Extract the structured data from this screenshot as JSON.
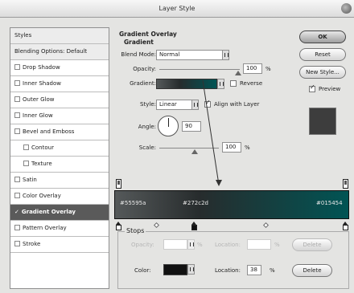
{
  "window": {
    "title": "Layer Style"
  },
  "sidebar": {
    "items": [
      {
        "label": "Styles",
        "checkbox": false,
        "checked": false,
        "active": false,
        "header": true
      },
      {
        "label": "Blending Options: Default",
        "checkbox": false,
        "checked": false,
        "active": false,
        "header": true
      },
      {
        "label": "Drop Shadow",
        "checkbox": true,
        "checked": false,
        "active": false
      },
      {
        "label": "Inner Shadow",
        "checkbox": true,
        "checked": false,
        "active": false
      },
      {
        "label": "Outer Glow",
        "checkbox": true,
        "checked": false,
        "active": false
      },
      {
        "label": "Inner Glow",
        "checkbox": true,
        "checked": false,
        "active": false
      },
      {
        "label": "Bevel and Emboss",
        "checkbox": true,
        "checked": false,
        "active": false
      },
      {
        "label": "Contour",
        "checkbox": true,
        "checked": false,
        "active": false,
        "sub": true
      },
      {
        "label": "Texture",
        "checkbox": true,
        "checked": false,
        "active": false,
        "sub": true
      },
      {
        "label": "Satin",
        "checkbox": true,
        "checked": false,
        "active": false
      },
      {
        "label": "Color Overlay",
        "checkbox": true,
        "checked": false,
        "active": false
      },
      {
        "label": "Gradient Overlay",
        "checkbox": true,
        "checked": true,
        "active": true
      },
      {
        "label": "Pattern Overlay",
        "checkbox": true,
        "checked": false,
        "active": false
      },
      {
        "label": "Stroke",
        "checkbox": true,
        "checked": false,
        "active": false
      }
    ]
  },
  "overlay": {
    "section_title": "Gradient Overlay",
    "group_title": "Gradient",
    "blend_mode_label": "Blend Mode:",
    "blend_mode_value": "Normal",
    "opacity_label": "Opacity:",
    "opacity_value": "100",
    "opacity_unit": "%",
    "gradient_label": "Gradient:",
    "reverse_label": "Reverse",
    "reverse_checked": false,
    "style_label": "Style:",
    "style_value": "Linear",
    "align_label": "Align with Layer",
    "align_checked": true,
    "angle_label": "Angle:",
    "angle_value": "90",
    "scale_label": "Scale:",
    "scale_value": "100",
    "scale_unit": "%"
  },
  "buttons": {
    "ok": "OK",
    "reset": "Reset",
    "new_style": "New Style...",
    "preview_label": "Preview",
    "preview_checked": true
  },
  "gradient_editor": {
    "stops_colors": [
      "#55595a",
      "#272c2d",
      "#015454"
    ],
    "stops_labels": [
      "#55595a",
      "#272c2d",
      "#015454"
    ],
    "stops_legend": "Stops",
    "opacity_label": "Opacity:",
    "opacity_unit": "%",
    "location_label_top": "Location:",
    "location_unit_top": "%",
    "delete_top": "Delete",
    "color_label": "Color:",
    "location_label": "Location:",
    "location_value": "38",
    "location_unit": "%",
    "delete_bottom": "Delete"
  }
}
